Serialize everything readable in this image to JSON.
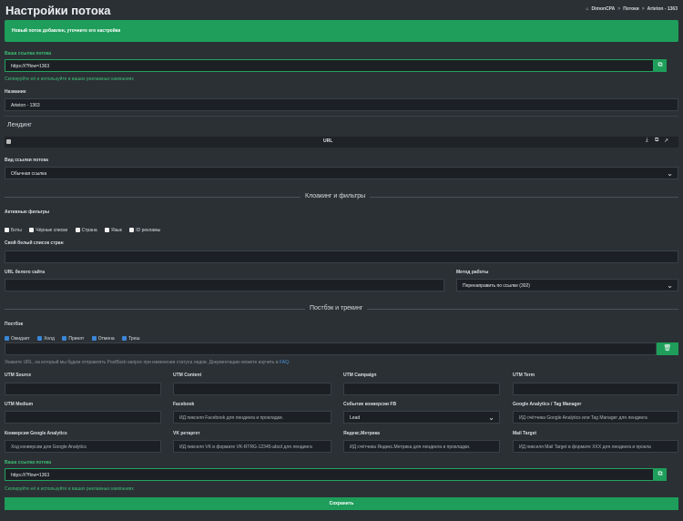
{
  "page": {
    "title": "Настройки потока",
    "breadcrumb": [
      "DimonCPA",
      "Потоки",
      "Arteton - 1363"
    ]
  },
  "alert": "Новый поток добавлен, уточните его настройки",
  "link_top": {
    "label": "Ваша ссылка потока",
    "value": "https:///?flow=1363",
    "hint": "Скопируйте её и используйте в ваших рекламных кампаниях"
  },
  "name": {
    "label": "Название",
    "value": "Arteton - 1363"
  },
  "landing": {
    "title": "Лендинг",
    "col_url": "URL"
  },
  "link_type": {
    "label": "Вид ссылки потока",
    "value": "Обычная ссылка"
  },
  "cloaking": {
    "title": "Клоакинг и фильтры",
    "filters_label": "Активные фильтры",
    "filters": [
      "Боты",
      "Чёрные списки",
      "Страна",
      "Язык",
      "ID рекламы"
    ],
    "countries_label": "Свой белый список стран",
    "white_url_label": "URL белого сайта",
    "method_label": "Метод работы",
    "method_value": "Перенаправить по ссылке (302)"
  },
  "postback": {
    "title": "Постбэк и трекинг",
    "label": "Постбэк",
    "statuses": [
      "Ожидает",
      "Холд",
      "Принят",
      "Отмена",
      "Треш"
    ],
    "hint_prefix": "Укажите URL, на который мы будем отправлять PostBack-запрос при изменении статуса лидов. Документацию можете изучить в ",
    "hint_link": "FAQ",
    "hint_suffix": "."
  },
  "tracking": {
    "utm_source": "UTM Source",
    "utm_content": "UTM Content",
    "utm_campaign": "UTM Campaign",
    "utm_term": "UTM Term",
    "utm_medium": "UTM Medium",
    "facebook_label": "Facebook",
    "facebook_ph": "ИД пикселя Facebook для лендинга и прокладки.",
    "fb_event_label": "Событие конверсии FB",
    "fb_event_value": "Lead",
    "ga_label": "Google Analytics / Tag Manager",
    "ga_ph": "ИД счётчика Google Analytics или Tag Manager для лендинга",
    "gconv_label": "Конверсия Google Analytics",
    "gconv_ph": "Ход конверсии для Google Analytics",
    "vk_label": "VK ретаргет",
    "vk_ph": "ИД пикселя VK в формате VK-RTRG-12345-abcd для лендинга",
    "ym_label": "Яндекс.Метрика",
    "ym_ph": "ИД счётчика Яндекс.Метрика для лендинга и прокладки.",
    "mt_label": "Mail Target",
    "mt_ph": "ИД пикселя Mail Target в формате XXX для лендинга и прокла"
  },
  "link_bottom": {
    "label": "Ваша ссылка потока",
    "value": "https:///?flow=1363",
    "hint": "Скопируйте её и используйте в ваших рекламных кампаниях"
  },
  "save_label": "Сохранить"
}
